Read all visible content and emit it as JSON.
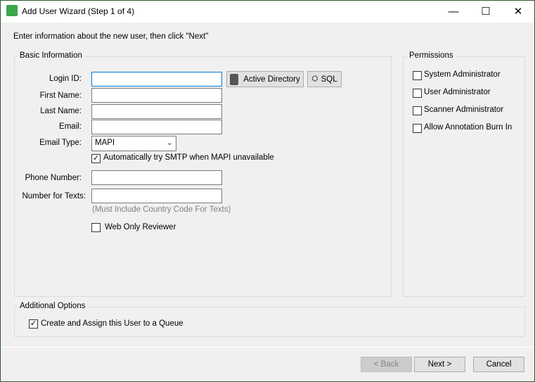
{
  "window": {
    "title": "Add User Wizard (Step 1 of 4)",
    "minimize": "—",
    "maximize": "☐",
    "close": "✕"
  },
  "instruction": "Enter information about the new user, then click \"Next\"",
  "basic": {
    "title": "Basic Information",
    "login_label": "Login ID:",
    "login_value": "",
    "first_label": "First Name:",
    "first_value": "",
    "last_label": "Last Name:",
    "last_value": "",
    "email_label": "Email:",
    "email_value": "",
    "email_type_label": "Email Type:",
    "email_type_value": "MAPI",
    "smtp_label": "Automatically try SMTP when MAPI unavailable",
    "smtp_checked": true,
    "phone_label": "Phone Number:",
    "phone_value": "",
    "texts_label": "Number for Texts:",
    "texts_value": "",
    "texts_hint": "(Must Include Country Code For Texts)",
    "web_label": "Web Only Reviewer",
    "web_checked": false,
    "ad_button": "Active Directory",
    "sql_button": "SQL"
  },
  "permissions": {
    "title": "Permissions",
    "items": [
      {
        "label": "System Administrator",
        "checked": false
      },
      {
        "label": "User Administrator",
        "checked": false
      },
      {
        "label": "Scanner Administrator",
        "checked": false
      },
      {
        "label": "Allow Annotation Burn In",
        "checked": false
      }
    ]
  },
  "additional": {
    "title": "Additional Options",
    "queue_label": "Create and Assign this User to a Queue",
    "queue_checked": true
  },
  "buttons": {
    "back": "< Back",
    "next": "Next >",
    "cancel": "Cancel"
  }
}
